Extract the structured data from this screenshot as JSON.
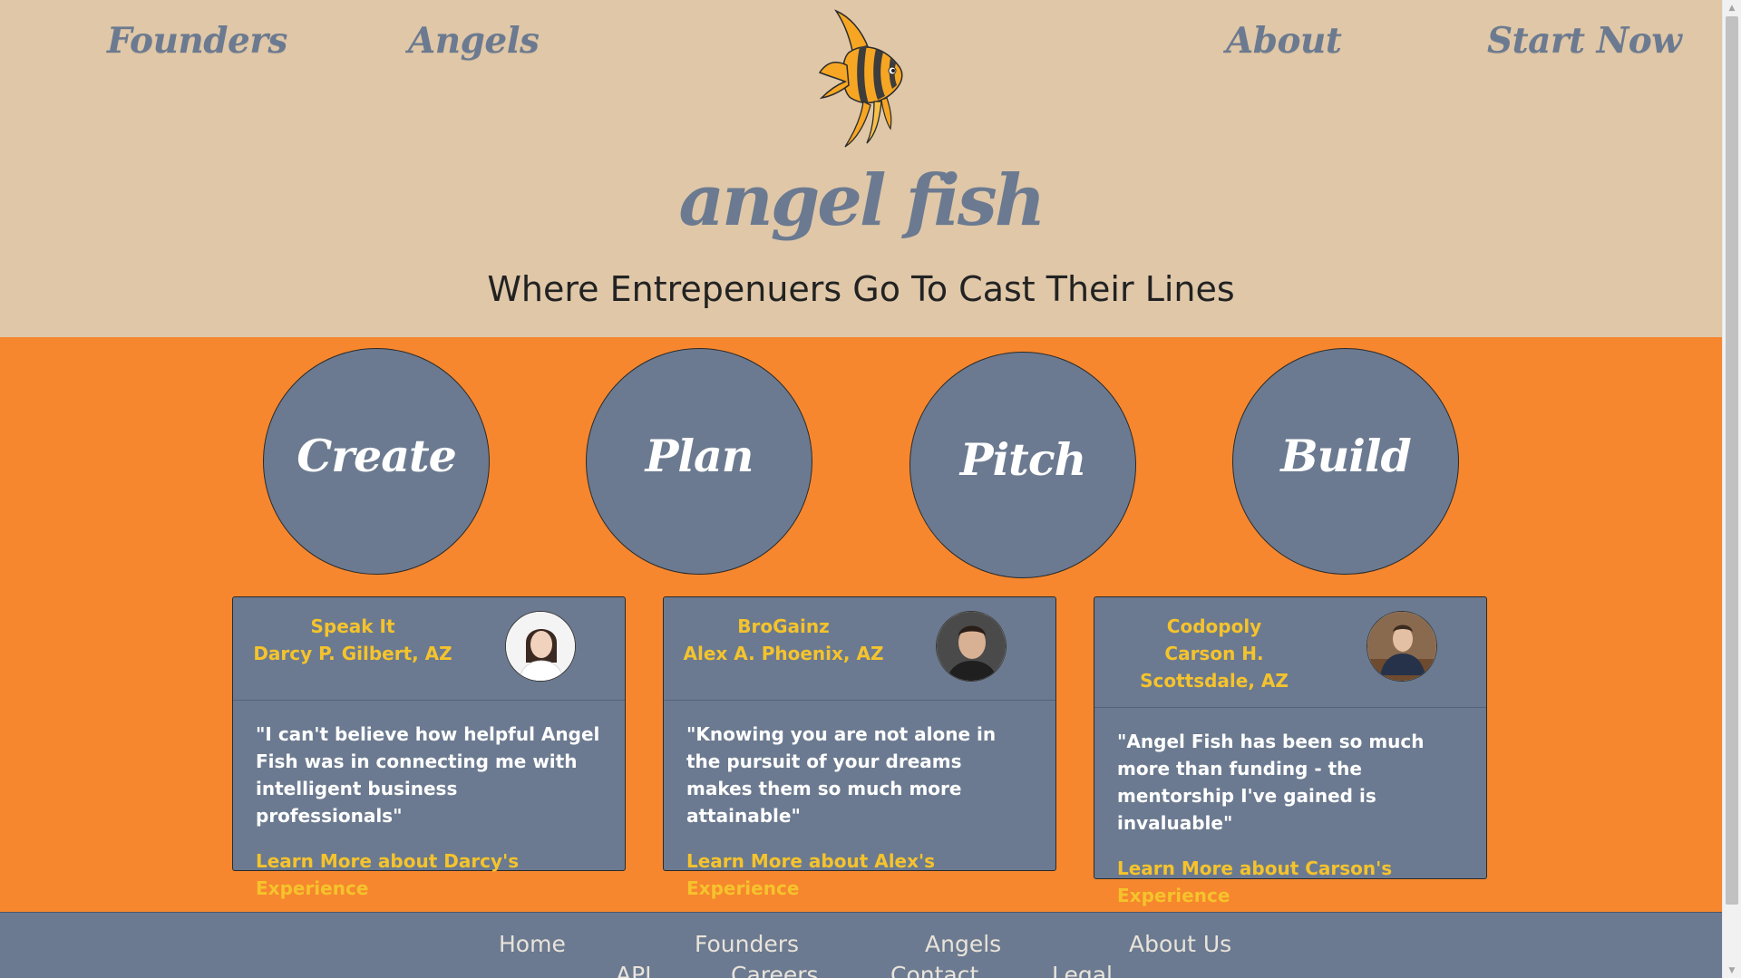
{
  "nav": {
    "founders": "Founders",
    "angels": "Angels",
    "about": "About",
    "start_now": "Start Now"
  },
  "brand": {
    "name": "angel fish",
    "tagline": "Where Entrepenuers Go To Cast Their Lines"
  },
  "steps": [
    "Create",
    "Plan",
    "Pitch",
    "Build"
  ],
  "testimonials": [
    {
      "company": "Speak It",
      "person": "Darcy P. Gilbert, AZ",
      "quote": "\"I can't believe how helpful Angel Fish was in connecting me with intelligent business professionals\"",
      "link": "Learn More about Darcy's Experience"
    },
    {
      "company": "BroGainz",
      "person": "Alex A. Phoenix, AZ",
      "quote": "\"Knowing you are not alone in the pursuit of your dreams makes them so much more attainable\"",
      "link": "Learn More about Alex's Experience"
    },
    {
      "company": "Codopoly",
      "person": "Carson H. Scottsdale, AZ",
      "quote": "\"Angel Fish has been so much more than funding - the mentorship I've gained is invaluable\"",
      "link": "Learn More about Carson's Experience"
    }
  ],
  "footer": {
    "home": "Home",
    "founders": "Founders",
    "angels": "Angels",
    "about_us": "About Us",
    "api": "API",
    "careers": "Careers",
    "contact": "Contact",
    "legal": "Legal"
  },
  "colors": {
    "header_bg": "#dfc7a8",
    "accent_orange": "#f6872e",
    "slate": "#6b7a90",
    "gold": "#f5c32c"
  }
}
